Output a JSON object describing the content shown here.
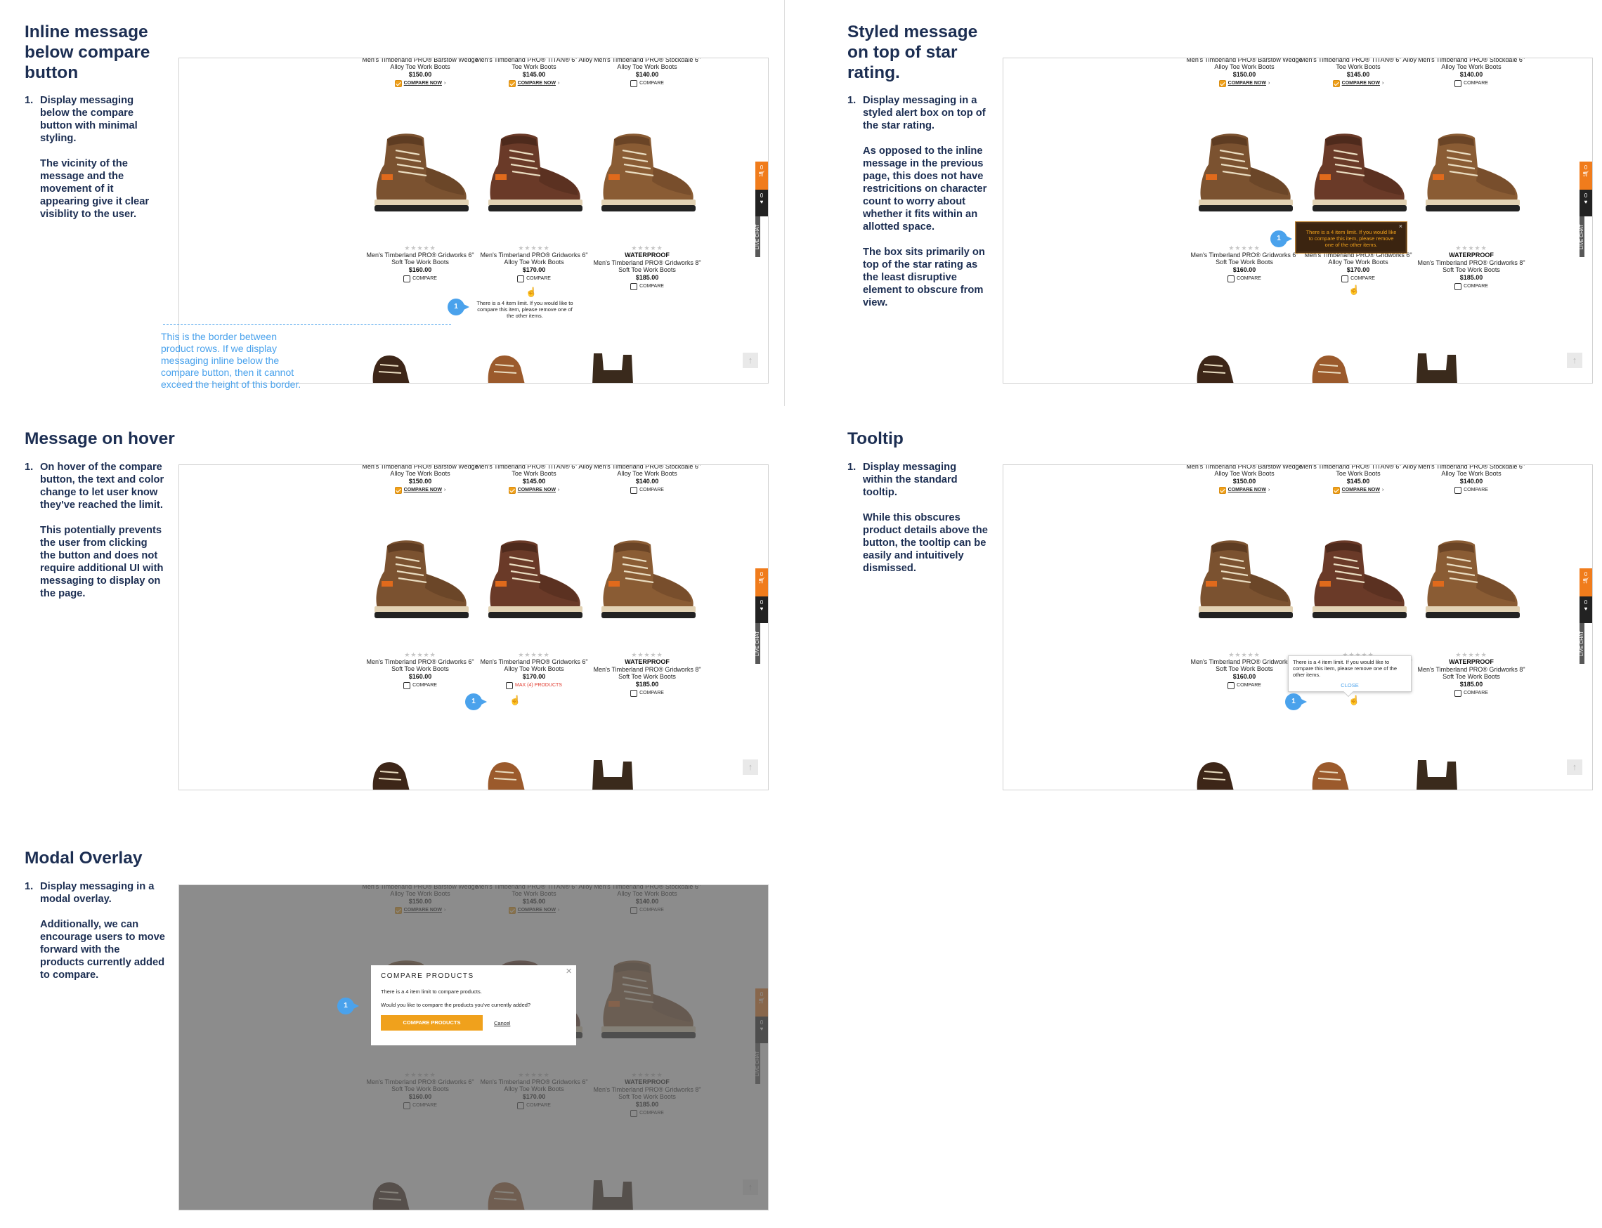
{
  "sections": [
    {
      "title": "Inline message below compare button",
      "num": "1.",
      "paras": [
        "Display messaging below the compare button with minimal styling.",
        "The vicinity of the message and the movement of it appearing give it clear visiblity to the user."
      ]
    },
    {
      "title": "Styled message on top of star rating.",
      "num": "1.",
      "paras": [
        "Display messaging in a styled alert box on top of the star rating.",
        "As opposed to the inline message in the previous page, this does not have restricitions on character count to worry about whether it fits within an allotted space.",
        "The box sits primarily on top of the star rating as the least disruptive element to obscure from view."
      ]
    },
    {
      "title": "Message on hover",
      "num": "1.",
      "paras": [
        "On hover of the compare button, the text and color change to let user know they've reached the limit.",
        "This potentially prevents the user from clicking the button and does not require additional UI with messaging to display on the page."
      ]
    },
    {
      "title": "Tooltip",
      "num": "1.",
      "paras": [
        "Display messaging within the standard tooltip.",
        "While this obscures product details above the button, the tooltip can be easily and intuitively dismissed."
      ]
    },
    {
      "title": "Modal Overlay",
      "num": "1.",
      "paras": [
        "Display messaging in a modal overlay.",
        "Additionally, we can encourage users to move forward with the products currently added to compare."
      ]
    }
  ],
  "annotation": "This is the border between product rows. If we display messaging inline below the compare button, then it cannot exceed the height of this border.",
  "top_products": [
    {
      "name": "Men's Timberland PRO® Barstow Wedge Alloy Toe Work Boots",
      "price": "$150.00",
      "compare": "COMPARE NOW",
      "checked": true
    },
    {
      "name": "Men's Timberland PRO® TITAN® 6\" Alloy Toe Work Boots",
      "price": "$145.00",
      "compare": "COMPARE NOW",
      "checked": true
    },
    {
      "name": "Men's Timberland PRO® Stockdale 6\" Alloy Toe Work Boots",
      "price": "$140.00",
      "compare": "COMPARE",
      "checked": false
    }
  ],
  "products": [
    {
      "stars": "★★★★★",
      "tag": "",
      "name": "Men's Timberland PRO® Gridworks 6\" Soft Toe Work Boots",
      "price": "$160.00",
      "compare": "COMPARE"
    },
    {
      "stars": "★★★★★",
      "tag": "",
      "name": "Men's Timberland PRO® Gridworks 6\" Alloy Toe Work Boots",
      "price": "$170.00",
      "compare": "COMPARE"
    },
    {
      "stars": "★★★★★",
      "tag": "WATERPROOF",
      "name": "Men's Timberland PRO® Gridworks 8\" Soft Toe Work Boots",
      "price": "$185.00",
      "compare": "COMPARE"
    }
  ],
  "messages": {
    "inline": "There is a 4 item limit. If you would like to compare this item, please remove one of the other items.",
    "styled": "There is a 4 item limit. If you would like to compare this item, please remove one of the other items.",
    "hover": "MAX (4) PRODUCTS",
    "tooltip": "There is a 4 item limit. If you would like to compare this item, please remove one of the other items.",
    "tooltip_close": "CLOSE"
  },
  "modal": {
    "title": "COMPARE PRODUCTS",
    "line1": "There is a 4 item limit to compare products.",
    "line2": "Would you like to compare the products you've currently added?",
    "button": "COMPARE PRODUCTS",
    "cancel": "Cancel"
  },
  "side": {
    "cart": "0",
    "wish": "0",
    "chat": "LIVE CHAT"
  },
  "badge": "1",
  "colors": {
    "heading": "#1c2e52",
    "accent": "#f0a11c",
    "badge": "#4aa2ec",
    "cart": "#f07c1c"
  }
}
